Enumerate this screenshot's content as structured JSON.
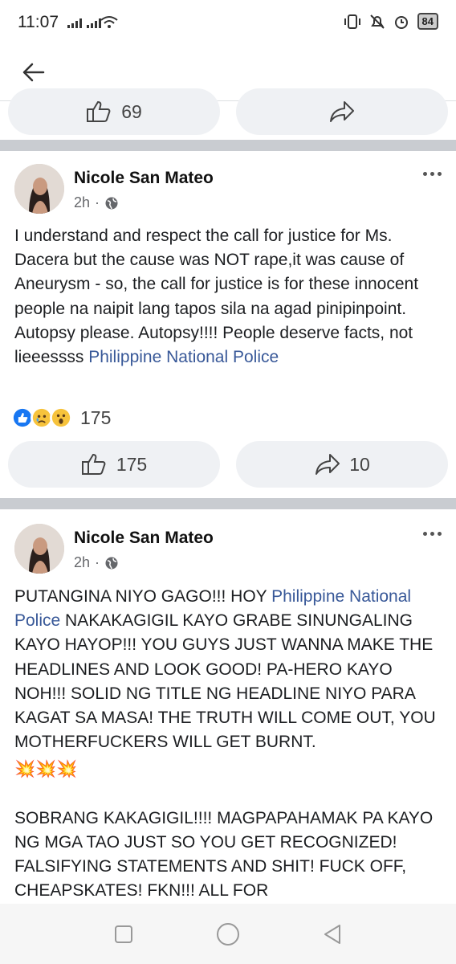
{
  "status_bar": {
    "time": "11:07",
    "battery": "84"
  },
  "top_action_bar": {
    "like_count": "69",
    "share_count": ""
  },
  "post1": {
    "author": "Nicole San Mateo",
    "time": "2h",
    "text_before_link": "I understand and respect the call for justice for Ms. Dacera but the cause was NOT rape,it was cause of Aneurysm - so, the call for justice is for these innocent people na naipit lang tapos sila na agad pinipinpoint. Autopsy please. Autopsy!!!! People deserve facts, not lieeessss ",
    "link": "Philippine National Police",
    "reaction_count": "175",
    "like_count": "175",
    "share_count": "10"
  },
  "post2": {
    "author": "Nicole San Mateo",
    "time": "2h",
    "text_start": "PUTANGINA NIYO GAGO!!! HOY ",
    "link": "Philippine National Police",
    "text_rest": " NAKAKAGIGIL KAYO GRABE SINUNGALING KAYO HAYOP!!! YOU GUYS JUST WANNA MAKE THE HEADLINES AND LOOK GOOD! PA-HERO KAYO NOH!!! SOLID NG TITLE NG HEADLINE NIYO PARA KAGAT SA MASA! THE TRUTH WILL COME OUT, YOU MOTHERFUCKERS WILL GET BURNT.",
    "emoji_line": "💥💥💥",
    "paragraph2": "SOBRANG KAKAGIGIL!!!! MAGPAPAHAMAK PA KAYO NG MGA TAO JUST SO YOU GET RECOGNIZED! FALSIFYING STATEMENTS AND SHIT! FUCK OFF, CHEAPSKATES! FKN!!! ALL FOR"
  },
  "colors": {
    "link": "#385898",
    "divider": "#c9ccd1",
    "pill_bg": "#eff1f4",
    "like_blue": "#1877f2"
  },
  "icons": [
    "back-arrow-icon",
    "like-icon",
    "share-icon",
    "globe-icon",
    "more-icon",
    "square-nav-icon",
    "circle-nav-icon",
    "triangle-back-icon"
  ]
}
